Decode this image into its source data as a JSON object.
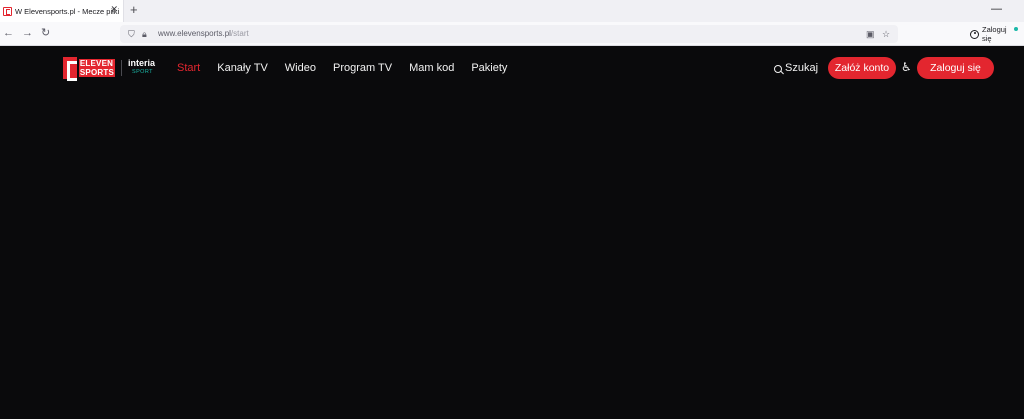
{
  "browser": {
    "tab_title": "W Elevensports.pl - Mecze piłki",
    "tab_close": "✕",
    "new_tab": "+",
    "minimize": "—",
    "back": "←",
    "forward": "→",
    "reload": "↻",
    "url_host": "www.elevensports.pl",
    "url_path": "/start",
    "login_label": "Zaloguj się",
    "icons": [
      "e-favicon-icon",
      "shield-icon",
      "lock-icon",
      "reader-icon",
      "star-icon",
      "account-icon"
    ]
  },
  "site": {
    "logo": {
      "line1": "ELEVEN",
      "line2": "SPORTS"
    },
    "partner": {
      "name": "interia",
      "sub": "SPORT"
    },
    "nav": [
      {
        "label": "Start",
        "active": true
      },
      {
        "label": "Kanały TV",
        "active": false
      },
      {
        "label": "Wideo",
        "active": false
      },
      {
        "label": "Program TV",
        "active": false
      },
      {
        "label": "Mam kod",
        "active": false
      },
      {
        "label": "Pakiety",
        "active": false
      }
    ],
    "search_label": "Szukaj",
    "register_label": "Załóż konto",
    "login_label": "Zaloguj się",
    "colors": {
      "brand_red": "#e3262f",
      "teal": "#1bb8a8",
      "background": "#0a0a0c"
    }
  }
}
